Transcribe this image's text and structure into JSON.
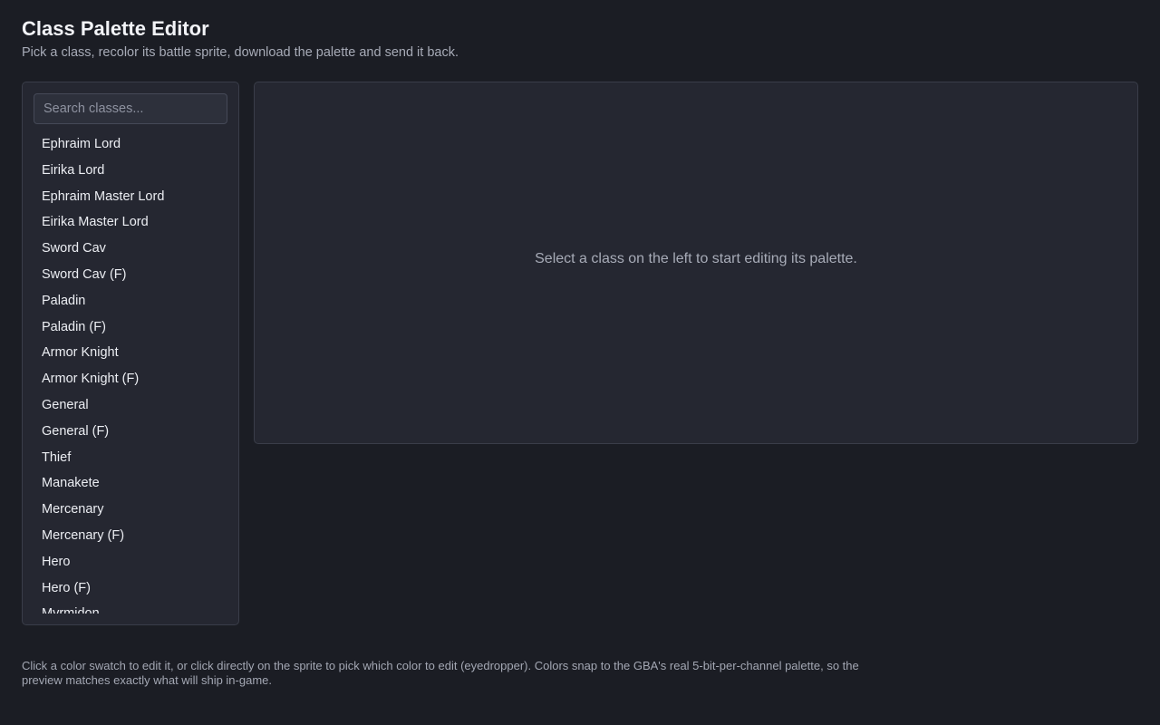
{
  "header": {
    "title": "Class Palette Editor",
    "subtitle": "Pick a class, recolor its battle sprite, download the palette and send it back."
  },
  "sidebar": {
    "search_placeholder": "Search classes...",
    "search_value": "",
    "classes": [
      "Ephraim Lord",
      "Eirika Lord",
      "Ephraim Master Lord",
      "Eirika Master Lord",
      "Sword Cav",
      "Sword Cav (F)",
      "Paladin",
      "Paladin (F)",
      "Armor Knight",
      "Armor Knight (F)",
      "General",
      "General (F)",
      "Thief",
      "Manakete",
      "Mercenary",
      "Mercenary (F)",
      "Hero",
      "Hero (F)",
      "Myrmidon"
    ]
  },
  "editor": {
    "empty_message": "Select a class on the left to start editing its palette."
  },
  "footer": {
    "help_text": "Click a color swatch to edit it, or click directly on the sprite to pick which color to edit (eyedropper). Colors snap to the GBA's real 5-bit-per-channel palette, so the preview matches exactly what will ship in-game."
  },
  "colors": {
    "background": "#1b1d24",
    "panel": "#252731",
    "border": "#3a3d49",
    "text": "#eceef3",
    "muted_text": "#a7abb7"
  }
}
